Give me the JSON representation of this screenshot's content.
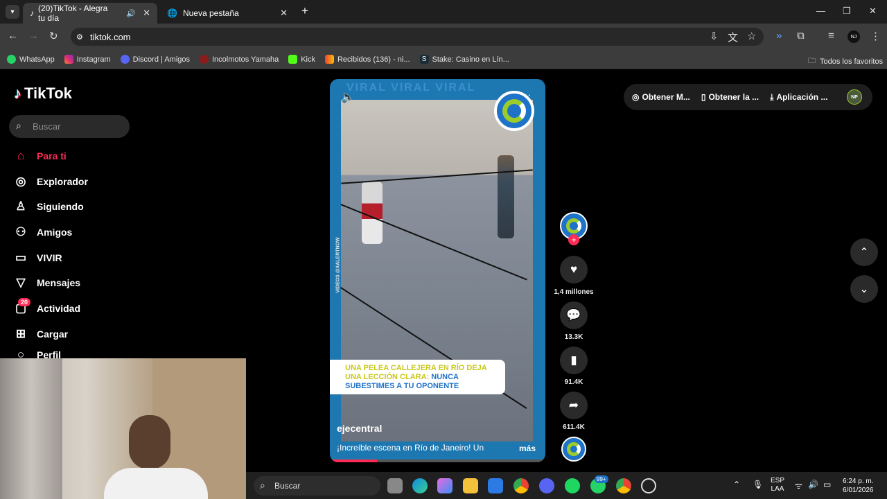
{
  "browser": {
    "tabs": [
      {
        "title": "(20)TikTok - Alegra tu día",
        "active": true
      },
      {
        "title": "Nueva pestaña",
        "active": false
      }
    ],
    "new_tab": "+",
    "window_controls": {
      "minimize": "—",
      "maximize": "❐",
      "close": "✕"
    },
    "url": "tiktok.com",
    "bookmarks": [
      "WhatsApp",
      "Instagram",
      "Discord | Amigos",
      "Incolmotos Yamaha",
      "Kick",
      "Recibidos (136) - ni...",
      "Stake: Casino en Lín..."
    ],
    "all_bookmarks": "Todos los favoritos",
    "profile_initials": "NJ"
  },
  "tiktok": {
    "logo": "TikTok",
    "search_placeholder": "Buscar",
    "nav": [
      {
        "label": "Para ti",
        "icon": "home-icon",
        "active": true
      },
      {
        "label": "Explorador",
        "icon": "compass-icon"
      },
      {
        "label": "Siguiendo",
        "icon": "following-icon"
      },
      {
        "label": "Amigos",
        "icon": "friends-icon"
      },
      {
        "label": "VIVIR",
        "icon": "live-icon"
      },
      {
        "label": "Mensajes",
        "icon": "messages-icon"
      },
      {
        "label": "Actividad",
        "icon": "activity-icon",
        "badge": "20"
      },
      {
        "label": "Cargar",
        "icon": "upload-icon"
      },
      {
        "label": "Perfil",
        "icon": "profile-icon"
      }
    ],
    "top_actions": [
      "Obtener M...",
      "Obtener la ...",
      "Aplicación ..."
    ],
    "top_avatar_initials": "NP",
    "video": {
      "overlay_text_yellow": "UNA PELEA CALLEJERA EN RÍO DEJA UNA LECCIÓN CLARA:",
      "overlay_text_blue": "NUNCA SUBESTIMES A TU OPONENTE",
      "watermark": "VIDEOS @XALERTNOW",
      "banner_text": "VIRAL VIRAL VIRAL",
      "author": "ejecentral",
      "description": "¡Increíble escena en Río de Janeiro! Un",
      "more": "más",
      "progress": 0.22
    },
    "rail": {
      "likes": "1,4 millones",
      "comments": "13.3K",
      "saves": "91.4K",
      "shares": "611.4K"
    }
  },
  "taskbar": {
    "search": "Buscar",
    "lang_top": "ESP",
    "lang_bottom": "LAA",
    "time": "6:24 p. m.",
    "date": "6/01/2026",
    "whatsapp_badge": "99+"
  },
  "colors": {
    "accent": "#fe2c55",
    "video_frame": "#1d77b0",
    "overlay_yellow": "#c8c81a",
    "overlay_blue": "#1e73c8"
  }
}
